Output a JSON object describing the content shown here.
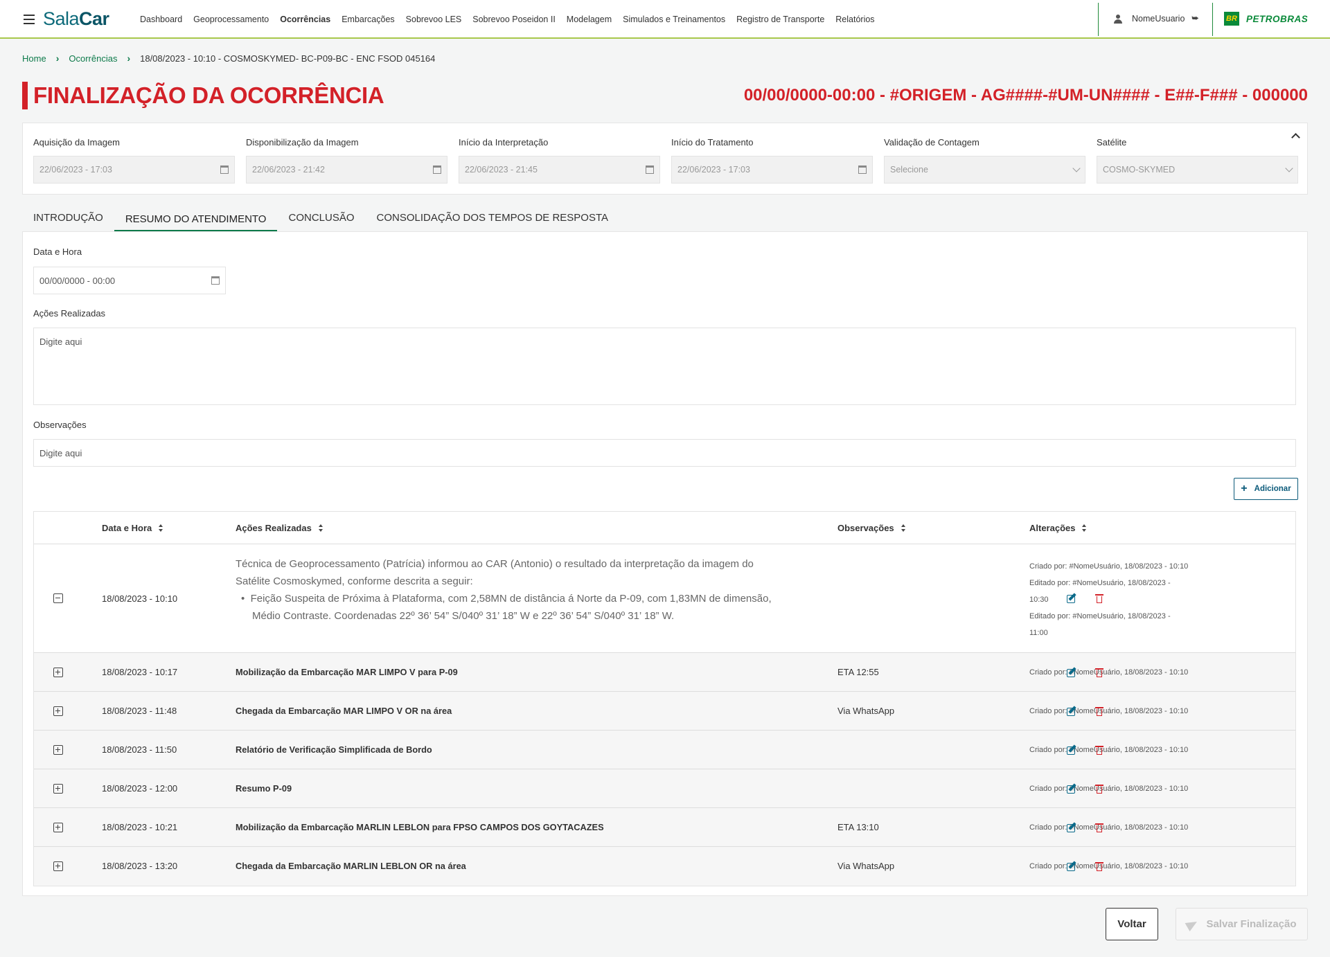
{
  "header": {
    "logo_part1": "Sala",
    "logo_part2": "Car",
    "nav": [
      "Dashboard",
      "Geoprocessamento",
      "Ocorrências",
      "Embarcações",
      "Sobrevoo LES",
      "Sobrevoo Poseidon II",
      "Modelagem",
      "Simulados e Treinamentos",
      "Registro de Transporte",
      "Relatórios"
    ],
    "active_nav": "Ocorrências",
    "username": "NomeUsuario",
    "brand_box": "BR",
    "brand": "PETROBRAS"
  },
  "breadcrumb": {
    "home": "Home",
    "section": "Ocorrências",
    "current": "18/08/2023 - 10:10 - COSMOSKYMED- BC-P09-BC - ENC FSOD 045164"
  },
  "page": {
    "title": "FINALIZAÇÃO DA OCORRÊNCIA",
    "code": "00/00/0000-00:00 - #ORIGEM - AG####-#UM-UN#### - E##-F### - 000000"
  },
  "fields": [
    {
      "label": "Aquisição da Imagem",
      "value": "22/06/2023 - 17:03",
      "type": "date"
    },
    {
      "label": "Disponibilização da Imagem",
      "value": "22/06/2023 - 21:42",
      "type": "date"
    },
    {
      "label": "Início da Interpretação",
      "value": "22/06/2023 - 21:45",
      "type": "date"
    },
    {
      "label": "Início do Tratamento",
      "value": "22/06/2023 - 17:03",
      "type": "date"
    },
    {
      "label": "Validação de Contagem",
      "value": "Selecione",
      "type": "select"
    },
    {
      "label": "Satélite",
      "value": "COSMO-SKYMED",
      "type": "select"
    }
  ],
  "tabs": [
    "INTRODUÇÃO",
    "RESUMO DO ATENDIMENTO",
    "CONCLUSÃO",
    "CONSOLIDAÇÃO DOS TEMPOS DE RESPOSTA"
  ],
  "active_tab": "RESUMO DO ATENDIMENTO",
  "form": {
    "datetime_label": "Data e Hora",
    "datetime_value": "00/00/0000 - 00:00",
    "actions_label": "Ações Realizadas",
    "actions_placeholder": "Digite aqui",
    "obs_label": "Observações",
    "obs_placeholder": "Digite aqui",
    "add_label": "Adicionar"
  },
  "table": {
    "columns": [
      "Data e Hora",
      "Ações Realizadas",
      "Observações",
      "Alterações"
    ],
    "expanded_row": {
      "datetime": "18/08/2023 - 10:10",
      "desc_line1": "Técnica de Geoprocessamento (Patrícia) informou ao CAR (Antonio) o resultado da interpretação da imagem do",
      "desc_line2": "Satélite Cosmoskymed, conforme descrita a seguir:",
      "bullet_line1": "Feição Suspeita de Próxima à Plataforma, com 2,58MN de distância á Norte da P-09, com 1,83MN de dimensão,",
      "bullet_line2": "Médio Contraste. Coordenadas 22º 36’ 54” S/040º 31’ 18” W e 22º 36’ 54” S/040º 31’ 18” W.",
      "alter1": "Criado por: #NomeUsuário, 18/08/2023 - 10:10",
      "alter2a": "Editado por: #NomeUsuário, 18/08/2023 -",
      "alter2b": "10:30",
      "alter3a": "Editado por: #NomeUsuário, 18/08/2023 -",
      "alter3b": "11:00"
    },
    "rows": [
      {
        "datetime": "18/08/2023 - 10:17",
        "action": "Mobilização da Embarcação MAR LIMPO V para P-09",
        "obs": "ETA 12:55",
        "alter": "Criado por: #NomeUsuário, 18/08/2023 - 10:10"
      },
      {
        "datetime": "18/08/2023 - 11:48",
        "action": "Chegada da Embarcação MAR LIMPO V OR na área",
        "obs": "Via WhatsApp",
        "alter": "Criado por: #NomeUsuário, 18/08/2023 - 10:10"
      },
      {
        "datetime": "18/08/2023 - 11:50",
        "action": "Relatório de Verificação Simplificada de Bordo",
        "obs": "",
        "alter": "Criado por: #NomeUsuário, 18/08/2023 - 10:10"
      },
      {
        "datetime": "18/08/2023 - 12:00",
        "action": "Resumo P-09",
        "obs": "",
        "alter": "Criado por: #NomeUsuário, 18/08/2023 - 10:10"
      },
      {
        "datetime": "18/08/2023 - 10:21",
        "action": "Mobilização da Embarcação MARLIN LEBLON para FPSO CAMPOS DOS GOYTACAZES",
        "obs": "ETA 13:10",
        "alter": "Criado por: #NomeUsuário, 18/08/2023 - 10:10"
      },
      {
        "datetime": "18/08/2023 - 13:20",
        "action": "Chegada da Embarcação MARLIN LEBLON OR na área",
        "obs": "Via WhatsApp",
        "alter": "Criado por: #NomeUsuário, 18/08/2023 - 10:10"
      }
    ]
  },
  "footer": {
    "back_label": "Voltar",
    "save_label": "Salvar Finalização"
  },
  "colors": {
    "accent_red": "#d32128",
    "accent_green": "#0d7a4a",
    "brand_teal": "#0d6a7a"
  }
}
